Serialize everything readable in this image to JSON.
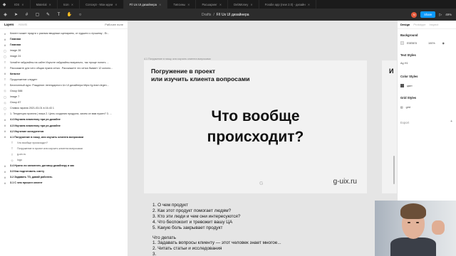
{
  "tabs": [
    {
      "label": "IOS",
      "active": false
    },
    {
      "label": "Material",
      "active": false
    },
    {
      "label": "Icon",
      "active": false
    },
    {
      "label": "Concept - Мои идеи",
      "active": false
    },
    {
      "label": "F/I Ux UI дизайнера",
      "active": true
    },
    {
      "label": "Типсины",
      "active": false
    },
    {
      "label": "Расшаринг",
      "active": false
    },
    {
      "label": "DebMoney",
      "active": false
    },
    {
      "label": "Foodie app (new 2.0) - дизайн",
      "active": false
    }
  ],
  "toolbar": {
    "breadcrumb_parent": "Drafts",
    "breadcrumb_sep": "/",
    "breadcrumb_current": "F/I Ux UI дизайнера",
    "avatar_letter": "N",
    "share_label": "Share",
    "zoom": "49%"
  },
  "left_panel": {
    "tab_layers": "Layers",
    "tab_assets": "Assets",
    "page_name": "Рабочее поле",
    "layers": [
      {
        "icon": "#",
        "label": "Клиент может придти с разным вводным сценарием, от худшего к лучшему - Er...",
        "bold": false,
        "indent": false
      },
      {
        "icon": "#",
        "label": "Главная",
        "bold": true,
        "indent": false
      },
      {
        "icon": "#",
        "label": "Главная",
        "bold": true,
        "indent": false
      },
      {
        "icon": "▢",
        "label": "image 28",
        "bold": false,
        "indent": false
      },
      {
        "icon": "▢",
        "label": "image 24",
        "bold": false,
        "indent": false
      },
      {
        "icon": "T",
        "label": "Читайте гайдлайны на сайте Изучите гайдлайны визуально, так проще понять ...",
        "bold": false,
        "indent": false
      },
      {
        "icon": "T",
        "label": "Расскажите для чего общая нужна сетка . Расскажите что сетка бывает 12 колоно...",
        "bold": false,
        "indent": false
      },
      {
        "icon": "#",
        "label": "Каталог",
        "bold": true,
        "indent": false
      },
      {
        "icon": "T",
        "label": "Продолжение следует",
        "bold": false,
        "indent": false
      },
      {
        "icon": "T",
        "label": "Бесплатный курс: Рождение легендарного Ux UI дизайнера https://g-learn.legen...",
        "bold": false,
        "indent": false
      },
      {
        "icon": "◇",
        "label": "Group 588",
        "bold": false,
        "indent": false
      },
      {
        "icon": "▢",
        "label": "image 7",
        "bold": false,
        "indent": false
      },
      {
        "icon": "◇",
        "label": "Group 87",
        "bold": false,
        "indent": false
      },
      {
        "icon": "▢",
        "label": "Снимок экрана 2021-03-01 в 16.43 1",
        "bold": false,
        "indent": false
      },
      {
        "icon": "T",
        "label": "1. Тенденция проекта | ниша 2. Цель создания продукта, зачем он вам нужен? 3. ...",
        "bold": false,
        "indent": false
      },
      {
        "icon": "#",
        "label": "4.4 Изучаем аналитику при ре-дизайне",
        "bold": true,
        "indent": false
      },
      {
        "icon": "#",
        "label": "4.3 Изучаем аналитику при ре-дизайне",
        "bold": true,
        "indent": false
      },
      {
        "icon": "#",
        "label": "4.2 Изучение конкурентов",
        "bold": true,
        "indent": false
      },
      {
        "icon": "#",
        "label": "4.1 Погружение в нишу, или изучить клиента вопросами",
        "bold": true,
        "indent": false
      },
      {
        "icon": "T",
        "label": "Что вообще происходит?",
        "bold": false,
        "indent": true
      },
      {
        "icon": "T",
        "label": "Погружение в проект или изучить клиента вопросами",
        "bold": false,
        "indent": true
      },
      {
        "icon": "T",
        "label": "g-uix.ru",
        "bold": false,
        "indent": true
      },
      {
        "icon": "◇",
        "label": "logo",
        "bold": false,
        "indent": true
      },
      {
        "icon": "#",
        "label": "3.4 Нужно ли заполнять договор дизайнеру и как",
        "bold": true,
        "indent": false
      },
      {
        "icon": "#",
        "label": "3.3 Как подготовить смету",
        "bold": true,
        "indent": false
      },
      {
        "icon": "#",
        "label": "3.2 Задавать ТЗ, давай работать",
        "bold": true,
        "indent": false
      },
      {
        "icon": "#",
        "label": "3.1 С чем прошел клиент",
        "bold": true,
        "indent": false
      }
    ]
  },
  "canvas": {
    "frame_label": "4.1 Погружение в нишу, или изучить клиента вопросами",
    "slide_title_line1": "Погружение в проект",
    "slide_title_line2": "или изучить клиента вопросами",
    "question_line1": "Что вообще",
    "question_line2": "происходит?",
    "slide_logo_letter": "G",
    "slide_url": "g-uix.ru",
    "next_slide_letter": "И",
    "questions": [
      "1. О чем  продукт",
      "2. Как этот продукт помогает людям?",
      "3. Кто эти люди и чем они интересуются?",
      "4. Что беспокоит и тревожит вашу ЦА",
      "5. Какую боль закрывает продукт"
    ],
    "todo_title": "Что делать",
    "todo": [
      "1. Задавать вопросы клиенту  — этот человек знает многое...",
      "2. Читать статьи и исследования",
      "3."
    ]
  },
  "right_panel": {
    "tab_design": "Design",
    "tab_prototype": "Prototype",
    "tab_inspect": "Inspect",
    "background_title": "Background",
    "background_hex": "E5E5E5",
    "background_opacity": "100%",
    "text_styles_title": "Text Styles",
    "text_style_item": "Ag  Н1",
    "color_styles_title": "Color Styles",
    "color_style_item": "цвет",
    "grid_styles_title": "Grid Styles",
    "grid_style_item": "grid",
    "export_title": "Export"
  }
}
